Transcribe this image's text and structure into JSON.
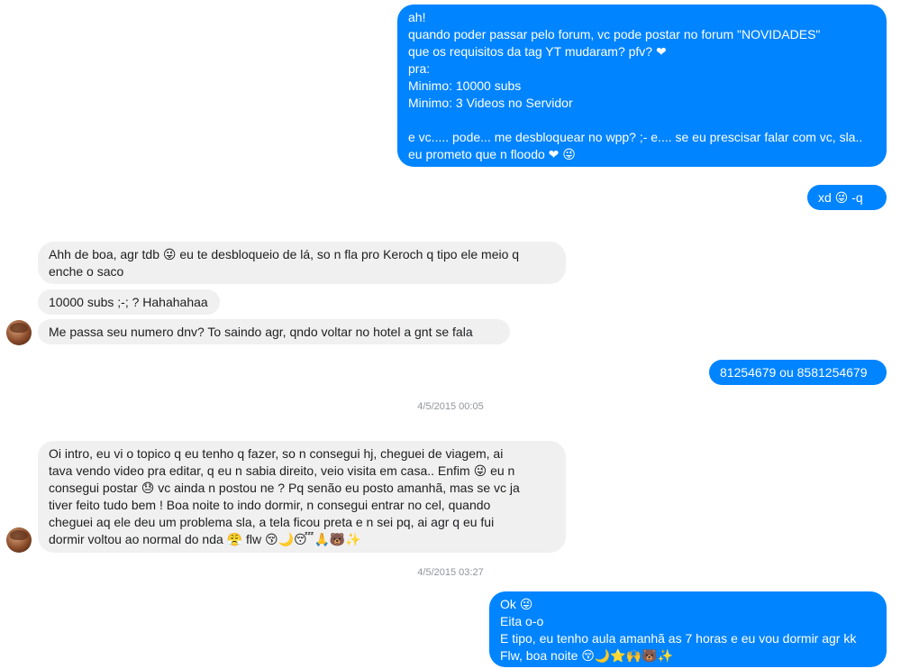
{
  "messages": [
    {
      "text": "ah!\nquando poder passar pelo forum, vc pode postar no forum \"NOVIDADES\"\nque os requisitos da tag YT mudaram? pfv? ❤\npra:\nMinimo: 10000 subs\nMinimo: 3 Videos no Servidor\n\ne vc..... pode... me desbloquear no wpp? ;- e.... se eu prescisar falar com vc, sla..\neu prometo que n floodo ❤ 😜"
    },
    {
      "text": "xd 😜 -q"
    },
    {
      "text": "Ahh de boa, agr tdb 😜 eu te desbloqueio de lá, so n fla pro Keroch q tipo ele meio q\nenche o saco"
    },
    {
      "text": "10000 subs ;-; ? Hahahahaa"
    },
    {
      "text": "Me passa seu numero dnv? To saindo agr, qndo voltar no hotel a gnt se fala"
    },
    {
      "text": "81254679 ou 8581254679"
    },
    {
      "text": "Oi intro, eu vi o topico q eu tenho q fazer, so n consegui hj, cheguei de viagem, ai\ntava vendo video pra editar, q eu n sabia direito, veio visita em casa.. Enfim 😜 eu n\nconsegui postar 😓 vc ainda n postou ne ? Pq senão eu posto amanhã, mas se vc ja\ntiver feito tudo bem ! Boa noite to indo dormir, n consegui entrar no cel, quando\ncheguei aq ele deu um problema sla, a tela ficou preta e n sei pq, ai agr q eu fui\ndormir voltou ao normal do nda 😤 flw 😚🌙😴🙏🐻✨"
    },
    {
      "text": "Ok 😜\nEita o-o\nE tipo, eu tenho aula amanhã as 7 horas e eu vou dormir agr kk\nFlw, boa noite 😚🌙⭐🙌🐻✨"
    }
  ],
  "timestamps": [
    "4/5/2015 00:05",
    "4/5/2015 03:27"
  ],
  "colors": {
    "outgoing": "#0084ff",
    "incoming": "#f1f0f0",
    "timestamp": "#90949c"
  }
}
